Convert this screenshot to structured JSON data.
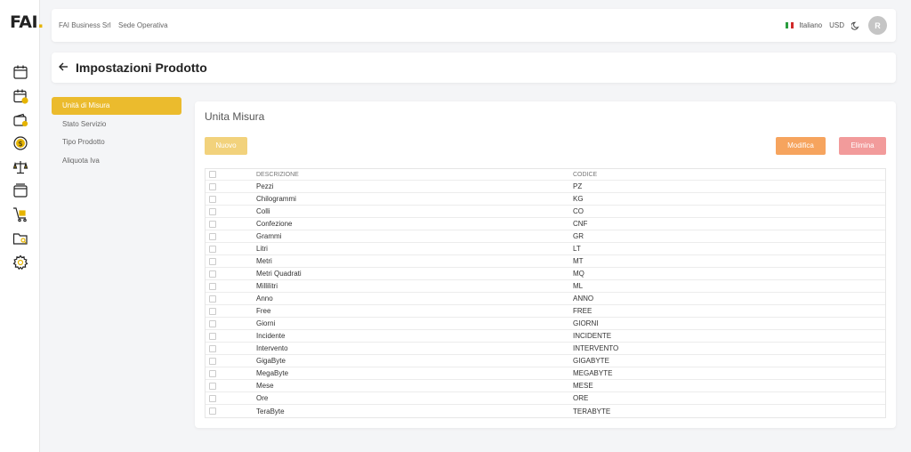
{
  "brand": {
    "logo_text": "FAI",
    "logo_dot": ".",
    "accent": "#ebbb2d"
  },
  "rail": {
    "icons": [
      "calendar-icon",
      "calendar-clock-icon",
      "wallet-icon",
      "dollar-coin-icon",
      "scales-icon",
      "archive-box-icon",
      "shopping-cart-icon",
      "folder-search-icon",
      "settings-gear-icon"
    ]
  },
  "topbar": {
    "company": "FAI Business Srl",
    "location": "Sede Operativa",
    "language": "Italiano",
    "currency": "USD",
    "avatar_initial": "R"
  },
  "page": {
    "title": "Impostazioni Prodotto"
  },
  "menu": {
    "items": [
      {
        "label": "Unità di Misura",
        "active": true
      },
      {
        "label": "Stato Servizio",
        "active": false
      },
      {
        "label": "Tipo Prodotto",
        "active": false
      },
      {
        "label": "Aliquota Iva",
        "active": false
      }
    ]
  },
  "card": {
    "title": "Unita Misura",
    "new_label": "Nuovo",
    "edit_label": "Modifica",
    "delete_label": "Elimina",
    "colors": {
      "new": "#f2d27c",
      "edit": "#f6a45e",
      "delete": "#f29b9b"
    }
  },
  "table": {
    "headers": [
      "DESCRIZIONE",
      "CODICE"
    ],
    "rows": [
      [
        "Pezzi",
        "PZ"
      ],
      [
        "Chilogrammi",
        "KG"
      ],
      [
        "Colli",
        "CO"
      ],
      [
        "Confezione",
        "CNF"
      ],
      [
        "Grammi",
        "GR"
      ],
      [
        "Litri",
        "LT"
      ],
      [
        "Metri",
        "MT"
      ],
      [
        "Metri Quadrati",
        "MQ"
      ],
      [
        "Millilitri",
        "ML"
      ],
      [
        "Anno",
        "ANNO"
      ],
      [
        "Free",
        "FREE"
      ],
      [
        "Giorni",
        "GIORNI"
      ],
      [
        "Incidente",
        "INCIDENTE"
      ],
      [
        "Intervento",
        "INTERVENTO"
      ],
      [
        "GigaByte",
        "GIGABYTE"
      ],
      [
        "MegaByte",
        "MEGABYTE"
      ],
      [
        "Mese",
        "MESE"
      ],
      [
        "Ore",
        "ORE"
      ],
      [
        "TeraByte",
        "TERABYTE"
      ]
    ]
  }
}
